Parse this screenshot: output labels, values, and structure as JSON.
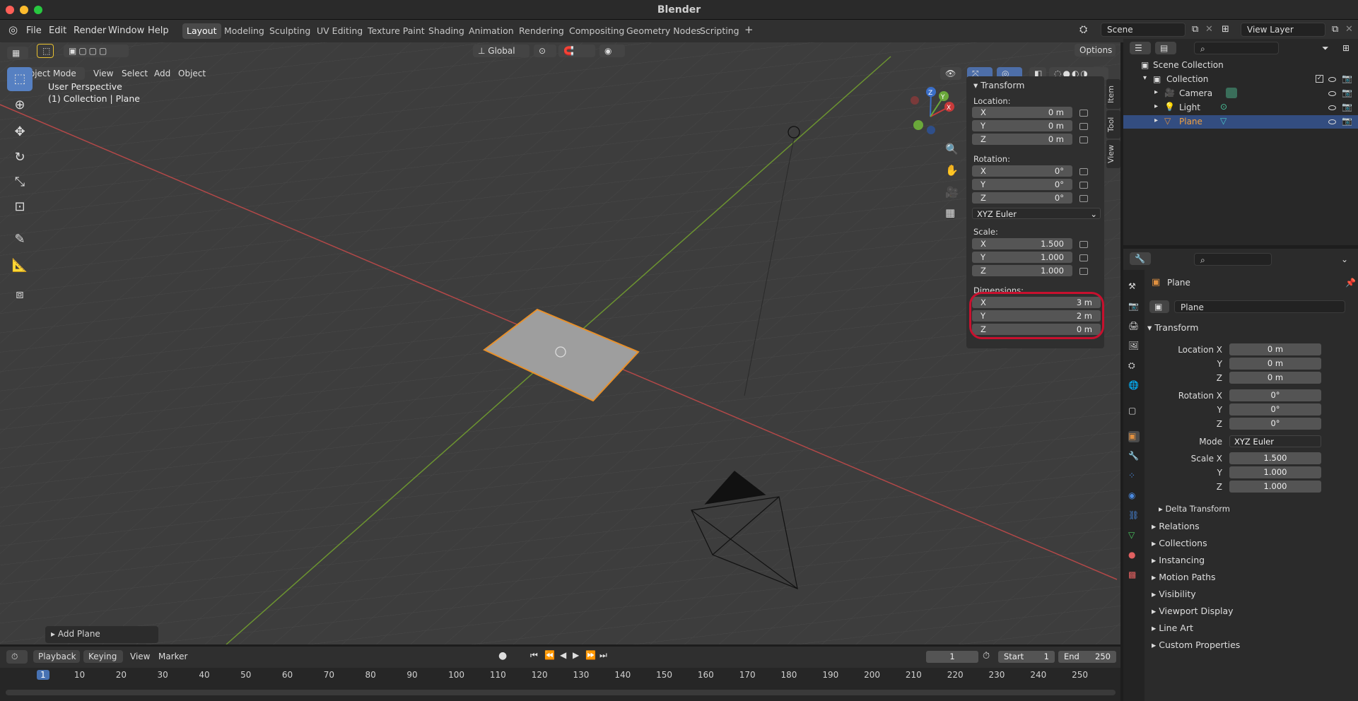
{
  "app": {
    "title": "Blender"
  },
  "menu": [
    "File",
    "Edit",
    "Render",
    "Window",
    "Help"
  ],
  "workspaces": [
    "Layout",
    "Modeling",
    "Sculpting",
    "UV Editing",
    "Texture Paint",
    "Shading",
    "Animation",
    "Rendering",
    "Compositing",
    "Geometry Nodes",
    "Scripting"
  ],
  "scene": {
    "name": "Scene",
    "view_layer": "View Layer"
  },
  "viewport": {
    "mode": "Object Mode",
    "menus": [
      "View",
      "Select",
      "Add",
      "Object"
    ],
    "orientation": "Global",
    "options_label": "Options",
    "info_line1": "User Perspective",
    "info_line2": "(1) Collection | Plane",
    "last_op": "Add Plane",
    "gizmo": {
      "x": "X",
      "y": "Y",
      "z": "Z"
    }
  },
  "npanel": {
    "header": "Transform",
    "location_label": "Location:",
    "location": [
      {
        "axis": "X",
        "val": "0 m"
      },
      {
        "axis": "Y",
        "val": "0 m"
      },
      {
        "axis": "Z",
        "val": "0 m"
      }
    ],
    "rotation_label": "Rotation:",
    "rotation": [
      {
        "axis": "X",
        "val": "0°"
      },
      {
        "axis": "Y",
        "val": "0°"
      },
      {
        "axis": "Z",
        "val": "0°"
      }
    ],
    "rotation_mode": "XYZ Euler",
    "scale_label": "Scale:",
    "scale": [
      {
        "axis": "X",
        "val": "1.500"
      },
      {
        "axis": "Y",
        "val": "1.000"
      },
      {
        "axis": "Z",
        "val": "1.000"
      }
    ],
    "dimensions_label": "Dimensions:",
    "dimensions": [
      {
        "axis": "X",
        "val": "3 m"
      },
      {
        "axis": "Y",
        "val": "2 m"
      },
      {
        "axis": "Z",
        "val": "0 m"
      }
    ],
    "tabs": [
      "Item",
      "Tool",
      "View"
    ],
    "highlight_color": "#c8102e"
  },
  "outliner": {
    "root": "Scene Collection",
    "collection": "Collection",
    "items": [
      "Camera",
      "Light",
      "Plane"
    ]
  },
  "properties": {
    "object_name": "Plane",
    "datablock_name": "Plane",
    "transform_header": "Transform",
    "location_label": "Location X",
    "location": [
      "0 m",
      "0 m",
      "0 m"
    ],
    "rotation_label": "Rotation X",
    "rotation": [
      "0°",
      "0°",
      "0°"
    ],
    "mode_label": "Mode",
    "mode_value": "XYZ Euler",
    "scale_label": "Scale X",
    "scale": [
      "1.500",
      "1.000",
      "1.000"
    ],
    "axis_y": "Y",
    "axis_z": "Z",
    "subsections": [
      "Delta Transform"
    ],
    "sections": [
      "Relations",
      "Collections",
      "Instancing",
      "Motion Paths",
      "Visibility",
      "Viewport Display",
      "Line Art",
      "Custom Properties"
    ]
  },
  "timeline": {
    "menus": [
      "Playback",
      "Keying",
      "View",
      "Marker"
    ],
    "current_frame": "1",
    "start_label": "Start",
    "start": "1",
    "end_label": "End",
    "end": "250",
    "ticks": [
      "1",
      "10",
      "20",
      "30",
      "40",
      "50",
      "60",
      "70",
      "80",
      "90",
      "100",
      "110",
      "120",
      "130",
      "140",
      "150",
      "160",
      "170",
      "180",
      "190",
      "200",
      "210",
      "220",
      "230",
      "240",
      "250"
    ]
  }
}
